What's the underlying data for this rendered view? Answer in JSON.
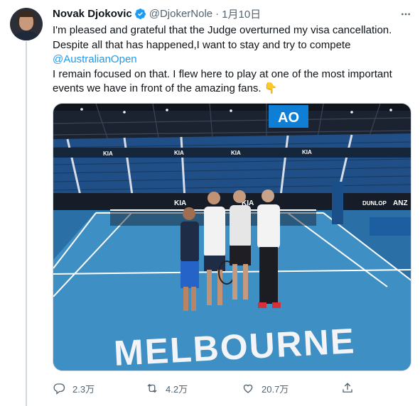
{
  "tweet": {
    "author_name": "Novak Djokovic",
    "handle": "@DjokerNole",
    "separator": "·",
    "date": "1月10日",
    "lines": [
      "I'm pleased and grateful that the Judge overturned my visa cancellation.",
      "Despite all that has happened,I want to stay and try to compete",
      "@AustralianOpen",
      "I remain focused on that. I flew here to play at one of the most important",
      "events we have in front of the amazing fans. "
    ],
    "emoji": "👇"
  },
  "photo": {
    "banner_text": "MELBOURNE",
    "logo_text": "AO",
    "sponsor_texts": [
      "KIA",
      "KIA",
      "KIA",
      "KIA",
      "KIA",
      "KIA"
    ],
    "dunlop_text": "DUNLOP",
    "anz_text": "ANZ",
    "court_color": "#3d8fc4",
    "surround_color": "#2a6fa6"
  },
  "actions": {
    "reply_count": "2.3万",
    "retweet_count": "4.2万",
    "like_count": "20.7万"
  },
  "colors": {
    "accent": "#1d9bf0",
    "muted": "#536471",
    "text": "#0f1419"
  }
}
